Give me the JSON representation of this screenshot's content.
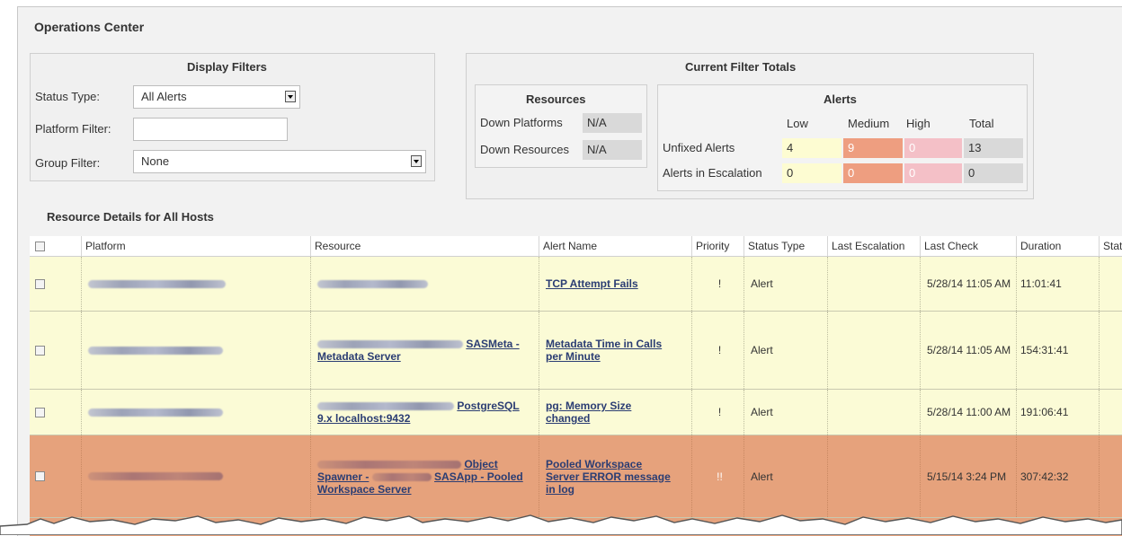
{
  "page": {
    "title": "Operations Center"
  },
  "display_filters": {
    "title": "Display Filters",
    "status_type_label": "Status Type:",
    "status_type_value": "All Alerts",
    "platform_filter_label": "Platform Filter:",
    "platform_filter_value": "",
    "group_filter_label": "Group Filter:",
    "group_filter_value": "None"
  },
  "totals": {
    "title": "Current Filter Totals",
    "resources": {
      "title": "Resources",
      "down_platforms_label": "Down Platforms",
      "down_platforms_value": "N/A",
      "down_resources_label": "Down Resources",
      "down_resources_value": "N/A"
    },
    "alerts": {
      "title": "Alerts",
      "headers": {
        "low": "Low",
        "medium": "Medium",
        "high": "High",
        "total": "Total"
      },
      "unfixed": {
        "label": "Unfixed Alerts",
        "low": "4",
        "medium": "9",
        "high": "0",
        "total": "13"
      },
      "escalation": {
        "label": "Alerts in Escalation",
        "low": "0",
        "medium": "0",
        "high": "0",
        "total": "0"
      }
    },
    "colors": {
      "low": "#fdfcd2",
      "medium": "#ee9e80",
      "high": "#f4c0c7",
      "total": "#d9d9d9"
    }
  },
  "details": {
    "title": "Resource Details for All Hosts",
    "columns": [
      "Platform",
      "Resource",
      "Alert Name",
      "Priority",
      "Status Type",
      "Last Escalation",
      "Last Check",
      "Duration",
      "Stat"
    ],
    "rows": [
      {
        "severity": "yellow",
        "resource_suffix": "",
        "resource_line2": "",
        "alert_name": [
          "TCP Attempt Fails"
        ],
        "priority": "!",
        "status_type": "Alert",
        "last_escalation": "",
        "last_check": "5/28/14 11:05 AM",
        "duration": "11:01:41"
      },
      {
        "severity": "yellow",
        "resource_suffix": "SASMeta -",
        "resource_line2": "Metadata Server",
        "alert_name": [
          "Metadata Time in Calls",
          "per Minute"
        ],
        "priority": "!",
        "status_type": "Alert",
        "last_escalation": "",
        "last_check": "5/28/14 11:05 AM",
        "duration": "154:31:41"
      },
      {
        "severity": "yellow",
        "resource_suffix": "PostgreSQL",
        "resource_line2": "9.x localhost:9432",
        "alert_name": [
          "pg: Memory Size",
          "changed"
        ],
        "priority": "!",
        "status_type": "Alert",
        "last_escalation": "",
        "last_check": "5/28/14 11:00 AM",
        "duration": "191:06:41"
      },
      {
        "severity": "orange",
        "resource_suffix": "Object",
        "resource_line2": "Spawner -",
        "resource_line2b": "SASApp - Pooled",
        "resource_line3": "Workspace Server",
        "alert_name": [
          "Pooled Workspace",
          "Server ERROR message",
          "in log"
        ],
        "priority": "!!",
        "status_type": "Alert",
        "last_escalation": "",
        "last_check": "5/15/14 3:24 PM",
        "duration": "307:42:32"
      }
    ]
  }
}
